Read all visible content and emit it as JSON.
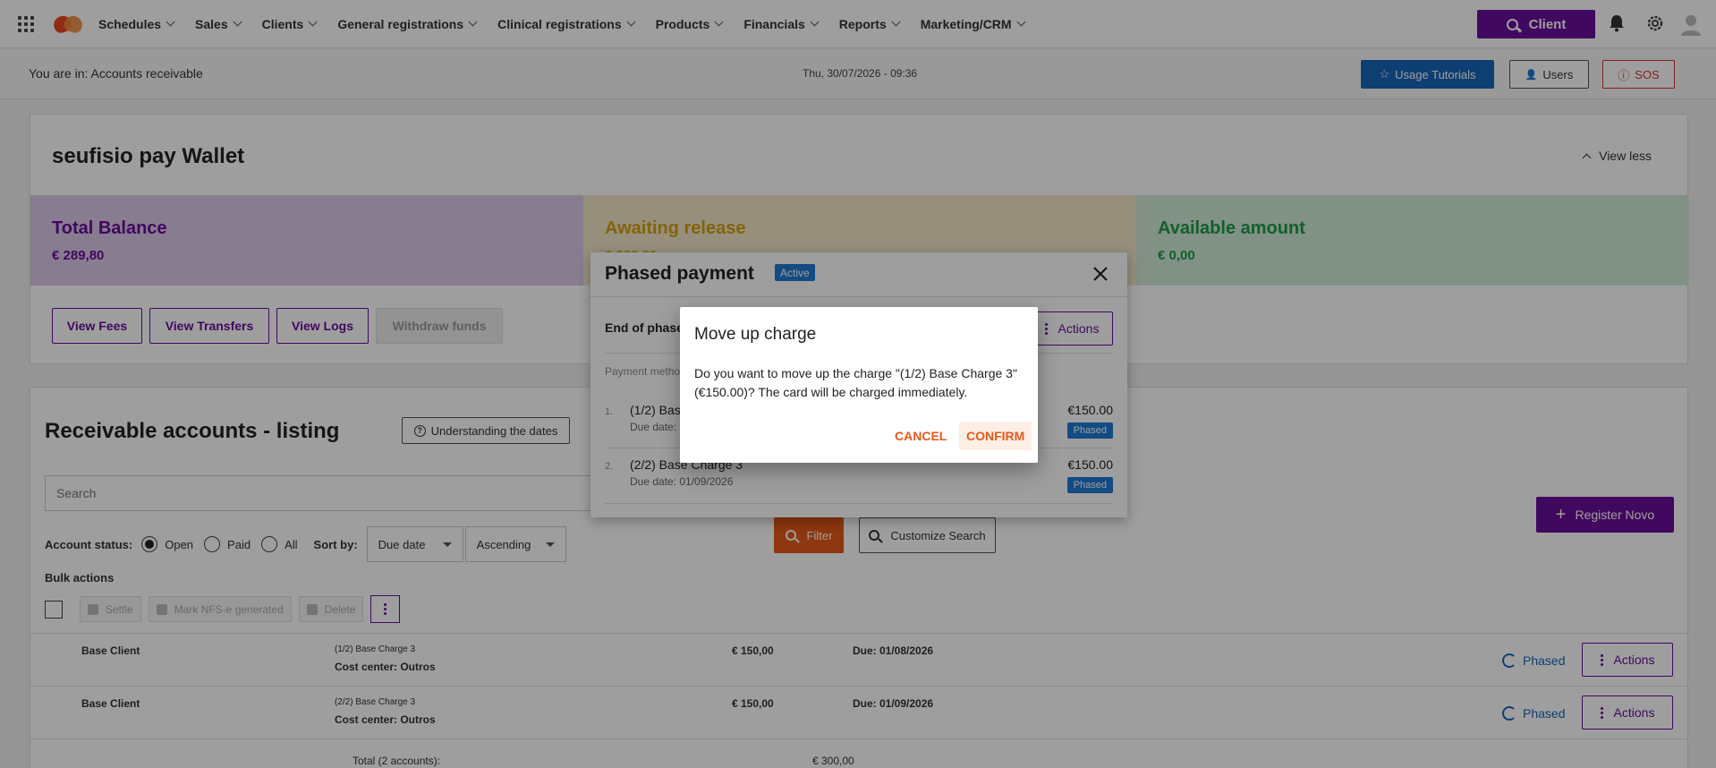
{
  "nav": {
    "menu": [
      "Schedules",
      "Sales",
      "Clients",
      "General registrations",
      "Clinical registrations",
      "Products",
      "Financials",
      "Reports",
      "Marketing/CRM"
    ],
    "client_btn": "Client"
  },
  "subbar": {
    "breadcrumb": "You are in: Accounts receivable",
    "datetime": "Thu, 30/07/2026 - 09:36",
    "tutorials": "Usage Tutorials",
    "users": "Users",
    "sos": "SOS"
  },
  "wallet": {
    "title": "seufisio pay Wallet",
    "view_less": "View less",
    "total_label": "Total Balance",
    "total_value": "€ 289,80",
    "awaiting_label": "Awaiting release",
    "awaiting_value": "€ 289,80",
    "available_label": "Available amount",
    "available_value": "€ 0,00",
    "buttons": [
      "View Fees",
      "View Transfers",
      "View Logs",
      "Withdraw funds"
    ]
  },
  "listing": {
    "title": "Receivable accounts - listing",
    "understanding": "Understanding the dates",
    "search_placeholder": "Search",
    "status_label": "Account status:",
    "status_options": [
      "Open",
      "Paid",
      "All"
    ],
    "sort_label": "Sort by:",
    "sort_by": "Due date",
    "sort_order": "Ascending",
    "filter": "Filter",
    "customize": "Customize Search",
    "register": "Register Novo",
    "bulk_label": "Bulk actions",
    "bulk_buttons": [
      "Settle",
      "Mark NFS-e generated",
      "Delete"
    ],
    "rows": [
      {
        "name": "Base Client",
        "charge": "(1/2) Base Charge 3",
        "cost_center": "Cost center: Outros",
        "amount": "€ 150,00",
        "due": "Due: 01/08/2026",
        "status": "Phased",
        "actions": "Actions"
      },
      {
        "name": "Base Client",
        "charge": "(2/2) Base Charge 3",
        "cost_center": "Cost center: Outros",
        "amount": "€ 150,00",
        "due": "Due: 01/09/2026",
        "status": "Phased",
        "actions": "Actions"
      }
    ],
    "total_label": "Total (2 accounts):",
    "total_value": "€ 300,00"
  },
  "phased_modal": {
    "title": "Phased payment",
    "badge": "Active",
    "end_label": "End of phase",
    "actions": "Actions",
    "payment_method": "Payment metho",
    "installments": [
      {
        "num": "1.",
        "title": "(1/2) Bas",
        "due": "Due date: ",
        "value": "€150.00",
        "badge": "Phased"
      },
      {
        "num": "2.",
        "title": "(2/2) Base Charge 3",
        "due": "Due date: 01/09/2026",
        "value": "€150.00",
        "badge": "Phased"
      }
    ]
  },
  "confirm_modal": {
    "title": "Move up charge",
    "text": "Do you want to move up the charge \"(1/2) Base Charge 3\" (€150.00)? The card will be charged immediately.",
    "cancel": "CANCEL",
    "confirm": "CONFIRM"
  }
}
